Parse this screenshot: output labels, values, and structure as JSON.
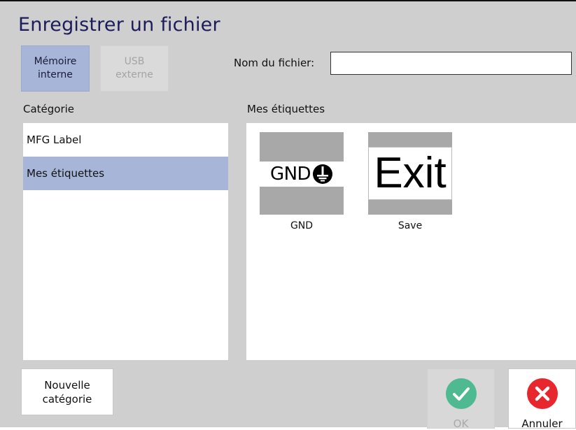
{
  "window": {
    "title": "Enregistrer un fichier"
  },
  "source": {
    "internal_label": "Mémoire\ninterne",
    "usb_label": "USB\nexterne"
  },
  "filename": {
    "label": "Nom du fichier:",
    "value": ""
  },
  "category": {
    "header": "Catégorie",
    "items": [
      {
        "label": "MFG Label",
        "selected": false
      },
      {
        "label": "Mes étiquettes",
        "selected": true
      }
    ]
  },
  "labels": {
    "header": "Mes étiquettes",
    "items": [
      {
        "content_text": "GND",
        "icon": "ground-symbol-icon",
        "caption": "GND"
      },
      {
        "content_text": "Exit",
        "caption": "Save"
      }
    ]
  },
  "buttons": {
    "new_category": "Nouvelle\ncatégorie",
    "ok": "OK",
    "cancel": "Annuler"
  },
  "colors": {
    "background": "#cfcfcf",
    "selected": "#a7b6d8",
    "title": "#1c1c5a",
    "ok_icon": "#4fb992",
    "cancel_icon": "#e8262e"
  }
}
